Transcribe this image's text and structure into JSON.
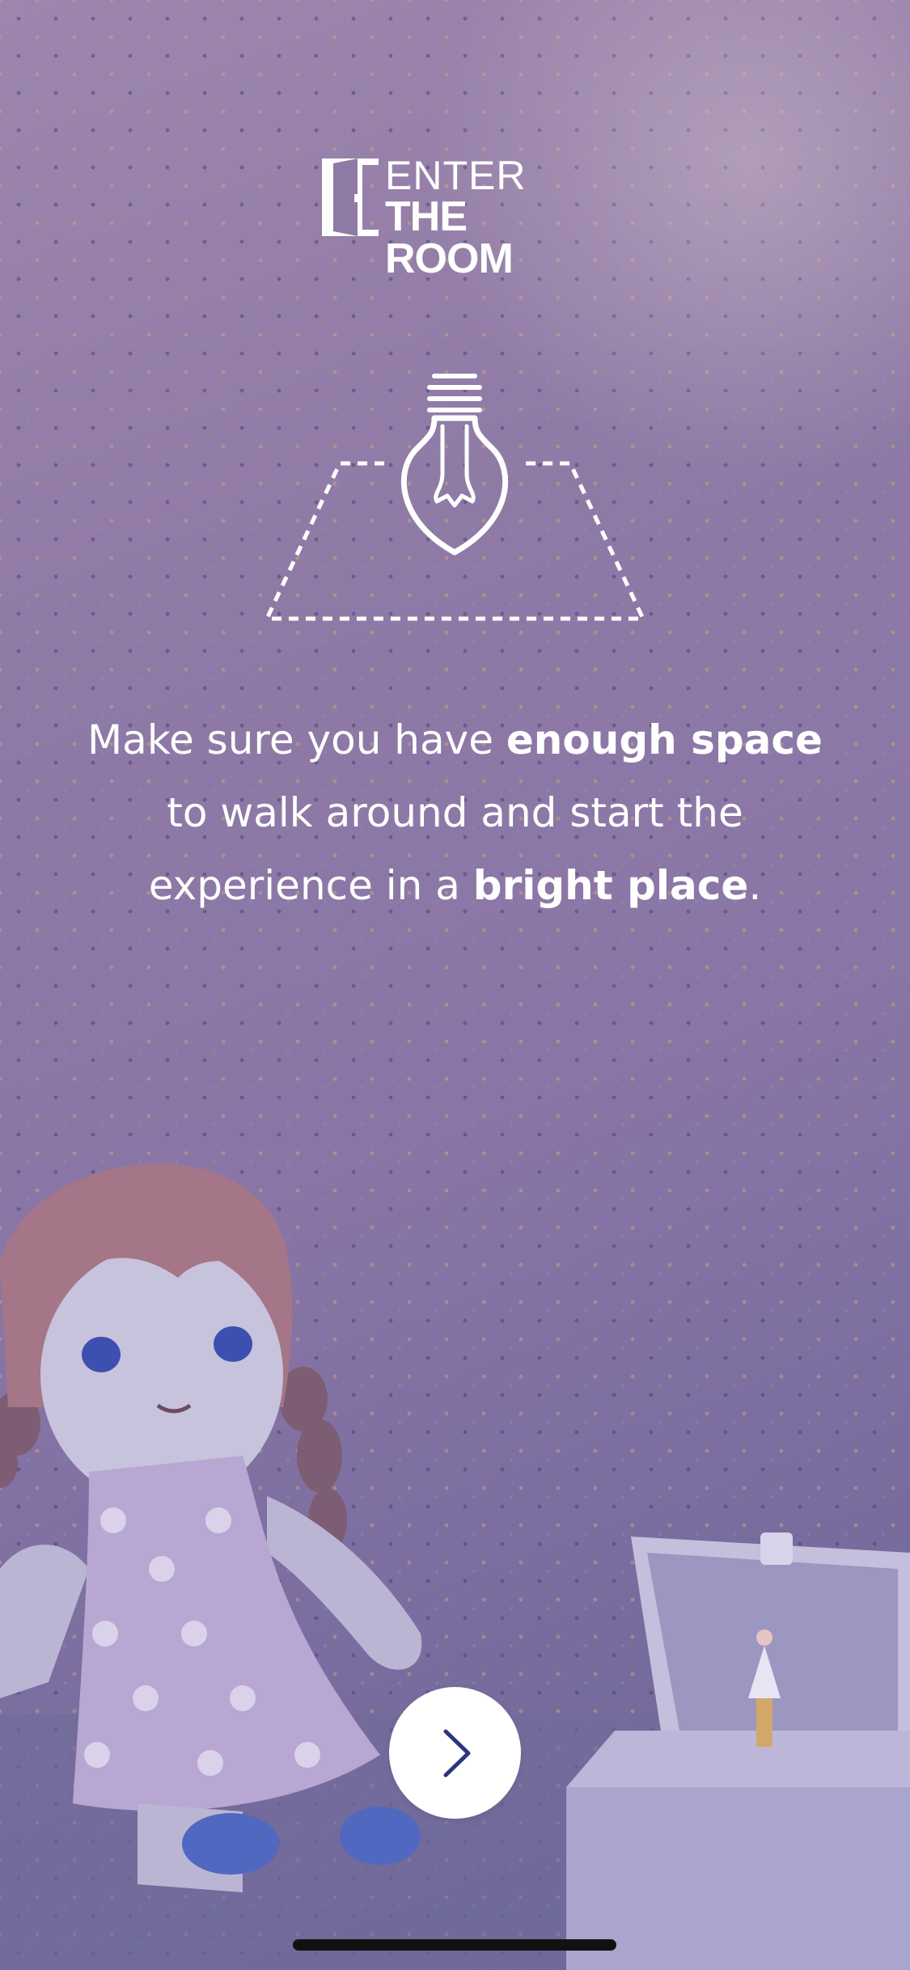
{
  "logo": {
    "line1": "ENTER",
    "line2": "THE ROOM"
  },
  "illustration": {
    "icon": "light-bulb-icon",
    "area_icon": "floor-space-icon"
  },
  "message": {
    "part1": "Make sure you have ",
    "bold1": "enough space",
    "part2": " to walk around and start the experience in a ",
    "bold2": "bright place",
    "part3": "."
  },
  "next_button": {
    "icon": "chevron-right-icon",
    "color": "#2b3580"
  },
  "colors": {
    "background_top": "#9d86ad",
    "background_bottom": "#6c6596",
    "text": "#ffffff"
  }
}
